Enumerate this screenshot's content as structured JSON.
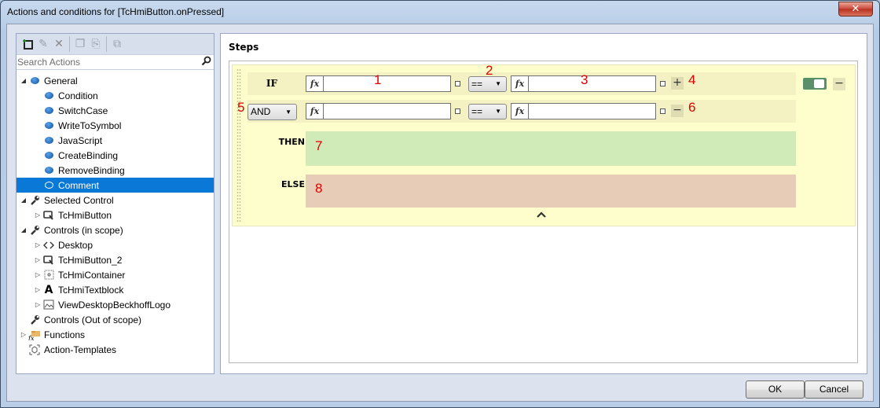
{
  "window": {
    "title": "Actions and conditions for [TcHmiButton.onPressed]",
    "close_glyph": "✕"
  },
  "left": {
    "toolbar": [
      {
        "name": "add-action-icon",
        "glyph": "⊞"
      },
      {
        "name": "edit-action-icon",
        "glyph": "✎"
      },
      {
        "name": "delete-action-icon",
        "glyph": "✕"
      },
      {
        "name": "copy-icon",
        "glyph": "❐"
      },
      {
        "name": "paste-icon",
        "glyph": "⎘"
      },
      {
        "name": "duplicate-icon",
        "glyph": "⧉"
      }
    ],
    "search_placeholder": "Search Actions",
    "tree": [
      {
        "label": "General",
        "level": 0,
        "expander": "◢",
        "icon": "blob"
      },
      {
        "label": "Condition",
        "level": 1,
        "expander": "",
        "icon": "blob"
      },
      {
        "label": "SwitchCase",
        "level": 1,
        "expander": "",
        "icon": "blob"
      },
      {
        "label": "WriteToSymbol",
        "level": 1,
        "expander": "",
        "icon": "blob"
      },
      {
        "label": "JavaScript",
        "level": 1,
        "expander": "",
        "icon": "blob"
      },
      {
        "label": "CreateBinding",
        "level": 1,
        "expander": "",
        "icon": "blob"
      },
      {
        "label": "RemoveBinding",
        "level": 1,
        "expander": "",
        "icon": "blob"
      },
      {
        "label": "Comment",
        "level": 1,
        "expander": "",
        "icon": "blob-outline",
        "selected": true
      },
      {
        "label": "Selected Control",
        "level": 0,
        "expander": "◢",
        "icon": "wrench"
      },
      {
        "label": "TcHmiButton",
        "level": 1,
        "expander": "▷",
        "icon": "button"
      },
      {
        "label": "Controls (in scope)",
        "level": 0,
        "expander": "◢",
        "icon": "wrench"
      },
      {
        "label": "Desktop",
        "level": 1,
        "expander": "▷",
        "icon": "code"
      },
      {
        "label": "TcHmiButton_2",
        "level": 1,
        "expander": "▷",
        "icon": "button"
      },
      {
        "label": "TcHmiContainer",
        "level": 1,
        "expander": "▷",
        "icon": "container"
      },
      {
        "label": "TcHmiTextblock",
        "level": 1,
        "expander": "▷",
        "icon": "text"
      },
      {
        "label": "ViewDesktopBeckhoffLogo",
        "level": 1,
        "expander": "▷",
        "icon": "image"
      },
      {
        "label": "Controls (Out of scope)",
        "level": 0,
        "expander": "",
        "icon": "wrench"
      },
      {
        "label": "Functions",
        "level": -1,
        "expander": "▷",
        "icon": "functions"
      },
      {
        "label": "Action-Templates",
        "level": 0,
        "expander": "",
        "icon": "template"
      }
    ]
  },
  "steps": {
    "heading": "Steps",
    "if_label": "IF",
    "and_select": "AND",
    "operator_1": "==",
    "operator_2": "==",
    "fx": "fx",
    "expr1_value": "",
    "expr3_value": "",
    "expr4_value": "",
    "expr5_value": "",
    "add_glyph": "+",
    "remove_glyph": "−",
    "then_label": "THEN",
    "else_label": "ELSE",
    "collapse_glyph": "⌃",
    "enabled": true,
    "annotations": [
      "1",
      "2",
      "3",
      "4",
      "5",
      "6",
      "7",
      "8"
    ]
  },
  "buttons": {
    "ok": "OK",
    "cancel": "Cancel"
  }
}
